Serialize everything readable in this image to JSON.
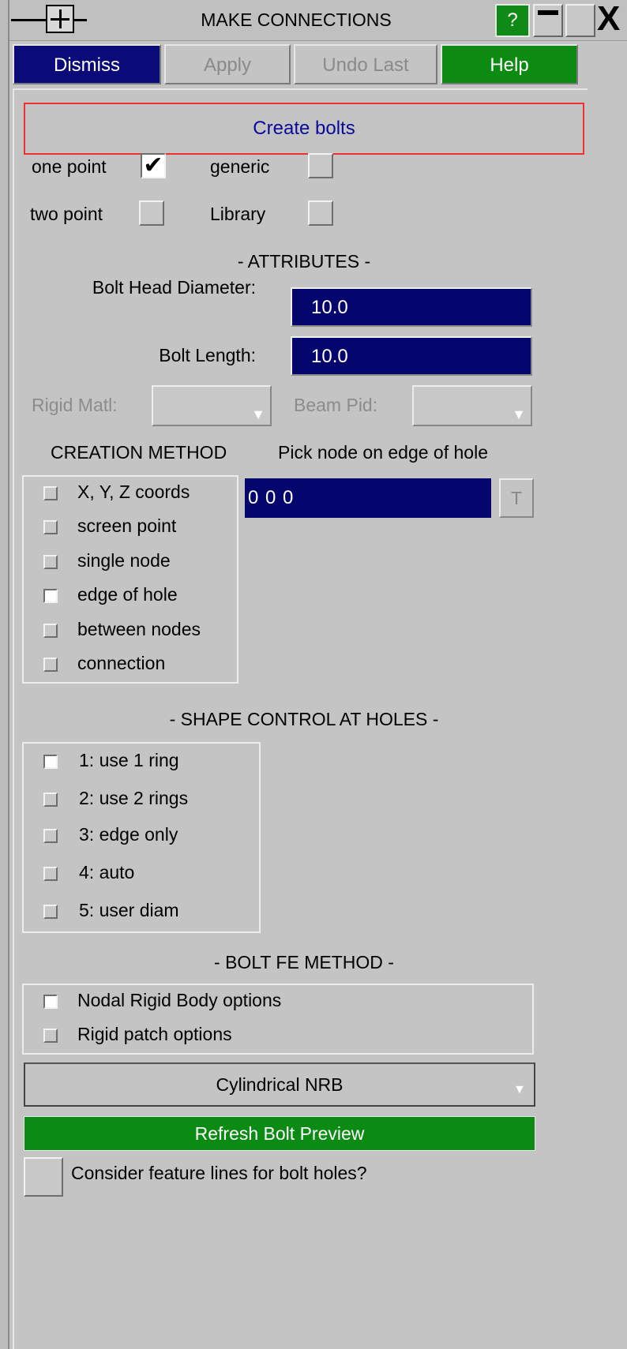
{
  "window": {
    "title": "MAKE CONNECTIONS",
    "help_symbol": "?",
    "close_symbol": "X"
  },
  "toolbar": {
    "dismiss": "Dismiss",
    "apply": "Apply",
    "undo_last": "Undo Last",
    "help": "Help"
  },
  "create_bolts": "Create bolts",
  "bolt_type": {
    "one_point": {
      "label": "one point",
      "checked": true
    },
    "generic": {
      "label": "generic",
      "checked": false
    },
    "two_point": {
      "label": "two point",
      "checked": false
    },
    "library": {
      "label": "Library",
      "checked": false
    },
    "check_mark": "✔"
  },
  "attributes": {
    "header": "- ATTRIBUTES -",
    "bolt_head_diameter_label": "Bolt Head Diameter:",
    "bolt_head_diameter_value": "10.0",
    "bolt_length_label": "Bolt Length:",
    "bolt_length_value": "10.0",
    "rigid_matl_label": "Rigid Matl:",
    "beam_pid_label": "Beam Pid:"
  },
  "creation_method": {
    "header": "CREATION METHOD",
    "instruction": "Pick node on edge of hole",
    "coordinates_value": "0 0 0",
    "t_button": "T",
    "options": [
      {
        "label": "X, Y, Z coords",
        "selected": false
      },
      {
        "label": "screen point",
        "selected": false
      },
      {
        "label": "single node",
        "selected": false
      },
      {
        "label": "edge of hole",
        "selected": true
      },
      {
        "label": "between nodes",
        "selected": false
      },
      {
        "label": "connection",
        "selected": false
      }
    ]
  },
  "shape_control": {
    "header": "- SHAPE CONTROL AT HOLES -",
    "options": [
      {
        "label": "1: use 1 ring",
        "selected": true
      },
      {
        "label": "2: use 2 rings",
        "selected": false
      },
      {
        "label": "3: edge only",
        "selected": false
      },
      {
        "label": "4: auto",
        "selected": false
      },
      {
        "label": "5: user diam",
        "selected": false
      }
    ]
  },
  "bolt_fe_method": {
    "header": "- BOLT FE METHOD -",
    "options": [
      {
        "label": "Nodal Rigid Body options",
        "selected": true
      },
      {
        "label": "Rigid patch options",
        "selected": false
      }
    ],
    "type_select": "Cylindrical NRB"
  },
  "refresh_preview": "Refresh Bolt Preview",
  "feature_lines": {
    "label": "Consider feature lines for bolt holes?",
    "checked": false
  },
  "colors": {
    "background": "#c4c4c4",
    "field_blue": "#05056e",
    "button_green": "#0c8a12",
    "dismiss_blue": "#0a0a78",
    "highlight_red": "#ee3030"
  }
}
